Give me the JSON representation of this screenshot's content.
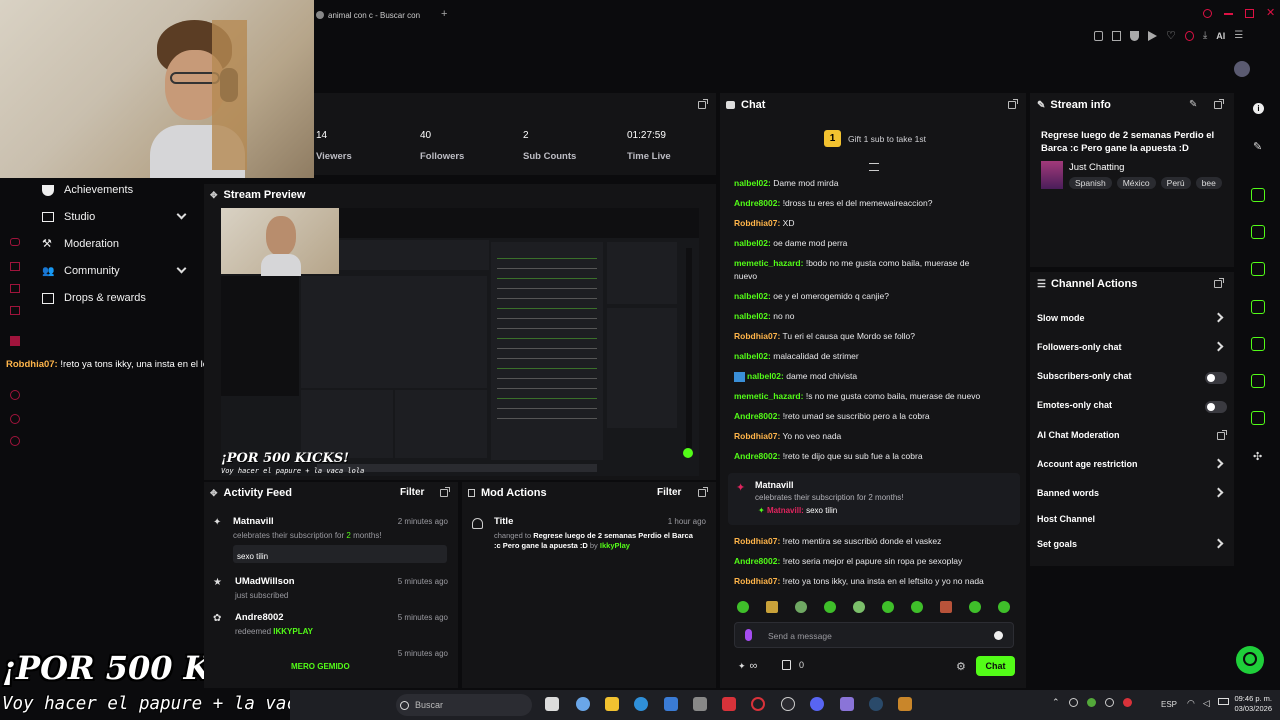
{
  "browser": {
    "tab_title": "animal con c - Buscar con",
    "new_tab_symbol": "+"
  },
  "stats": {
    "viewers_value": "14",
    "viewers_label": "Viewers",
    "followers_value": "40",
    "followers_label": "Followers",
    "subs_value": "2",
    "subs_label": "Sub Counts",
    "time_value": "01:27:59",
    "time_label": "Time Live"
  },
  "sidebar": {
    "items": [
      {
        "label": "Achievements"
      },
      {
        "label": "Studio"
      },
      {
        "label": "Moderation"
      },
      {
        "label": "Community"
      },
      {
        "label": "Drops & rewards"
      }
    ]
  },
  "overlay": {
    "chat_user": "Robdhia07:",
    "chat_text": "!reto ya tons ikky, una insta en el leftsito y yo no nada",
    "banner_title": "¡POR 500 KICKS!",
    "banner_sub": "Voy hacer el papure + la vaca lola"
  },
  "stream_preview": {
    "title": "Stream Preview",
    "mini_banner_title": "¡POR 500 KICKS!",
    "mini_banner_sub": "Voy hacer el papure + la vaca lola"
  },
  "activity_feed": {
    "title": "Activity Feed",
    "filter": "Filter",
    "items": [
      {
        "user": "Matnavill",
        "time": "2 minutes ago",
        "text_pre": "celebrates their subscription for",
        "count": "2",
        "text_post": "months!",
        "message": "sexo tilin"
      },
      {
        "user": "UMadWillson",
        "time": "5 minutes ago",
        "text": "just subscribed"
      },
      {
        "user": "Andre8002",
        "time": "5 minutes ago",
        "text_pre": "redeemed",
        "reward": "IKKYPLAY"
      },
      {
        "time": "5 minutes ago",
        "reward": "MERO GEMIDO"
      }
    ]
  },
  "mod_actions": {
    "title": "Mod Actions",
    "filter": "Filter",
    "item": {
      "label": "Title",
      "time": "1 hour ago",
      "changed": "changed to",
      "new_title": "Regrese luego de 2 semanas Perdio el Barca :c Pero gane la apuesta :D",
      "by": "by",
      "user": "IkkyPlay"
    }
  },
  "chat": {
    "title": "Chat",
    "gift_count": "1",
    "gift_text": "Gift 1 sub to take 1st",
    "messages": [
      {
        "user": "nalbel02:",
        "text": "Dame mod mirda",
        "color": "green"
      },
      {
        "user": "Andre8002:",
        "text": "!dross tu eres el del memewaireaccion?",
        "color": "green"
      },
      {
        "user": "Robdhia07:",
        "text": "XD",
        "color": "orange"
      },
      {
        "user": "nalbel02:",
        "text": "oe dame mod perra",
        "color": "green"
      },
      {
        "user": "memetic_hazard:",
        "text": "!bodo no me gusta como baila, muerase de",
        "text2": "nuevo",
        "color": "green"
      },
      {
        "user": "nalbel02:",
        "text": "oe y el omerogemido q canjie?",
        "color": "green"
      },
      {
        "user": "nalbel02:",
        "text": "no no",
        "color": "green"
      },
      {
        "user": "Robdhia07:",
        "text": "Tu eri el causa que Mordo se follo?",
        "color": "orange"
      },
      {
        "user": "nalbel02:",
        "text": "malacalidad de strimer",
        "color": "green"
      },
      {
        "user": "nalbel02:",
        "text": "dame mod chivista",
        "color": "green"
      },
      {
        "user": "memetic_hazard:",
        "text": "!s no me gusta como baila, muerase de nuevo",
        "color": "green"
      },
      {
        "user": "Andre8002:",
        "text": "!reto umad se suscribio pero a la cobra",
        "color": "green"
      },
      {
        "user": "Robdhia07:",
        "text": "Yo no veo nada",
        "color": "orange"
      },
      {
        "user": "Andre8002:",
        "text": "!reto te dijo que su sub fue a la cobra",
        "color": "green"
      }
    ],
    "sub_event": {
      "user": "Matnavill",
      "text": "celebrates their subscription for 2 months!",
      "echo_user": "Matnavill:",
      "echo_text": "sexo tilin"
    },
    "messages_after": [
      {
        "user": "Robdhia07:",
        "text": "!reto mentira se suscribió donde el vaskez",
        "color": "orange"
      },
      {
        "user": "Andre8002:",
        "text": "!reto seria mejor el papure sin ropa pe sexoplay",
        "color": "green"
      },
      {
        "user": "Robdhia07:",
        "text": "!reto ya tons ikky, una insta en el leftsito y yo no nada",
        "color": "orange"
      }
    ],
    "input_placeholder": "Send a message",
    "infinity": "∞",
    "count": "0",
    "send_label": "Chat"
  },
  "stream_info": {
    "title": "Stream info",
    "stream_title": "Regrese luego de 2 semanas Perdio el Barca :c Pero gane la apuesta :D",
    "category": "Just Chatting",
    "tags": [
      "Spanish",
      "México",
      "Perú",
      "bee"
    ]
  },
  "channel_actions": {
    "title": "Channel Actions",
    "items": [
      {
        "label": "Slow mode",
        "control": "chevron"
      },
      {
        "label": "Followers-only chat",
        "control": "chevron"
      },
      {
        "label": "Subscribers-only chat",
        "control": "toggle"
      },
      {
        "label": "Emotes-only chat",
        "control": "toggle"
      },
      {
        "label": "AI Chat Moderation",
        "control": "external"
      },
      {
        "label": "Account age restriction",
        "control": "chevron"
      },
      {
        "label": "Banned words",
        "control": "chevron"
      },
      {
        "label": "Host Channel",
        "control": "none"
      },
      {
        "label": "Set goals",
        "control": "chevron"
      }
    ]
  },
  "taskbar": {
    "search_placeholder": "Buscar",
    "lang": "ESP",
    "time": "09:46 p. m.",
    "date": "03/03/2026"
  },
  "colors": {
    "accent": "#53fc18",
    "bg": "#0b0b0d",
    "panel": "#141416"
  }
}
